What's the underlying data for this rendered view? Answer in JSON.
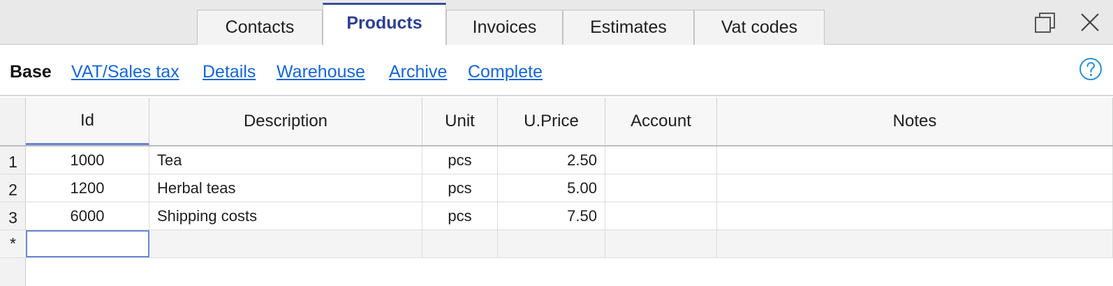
{
  "tabs": [
    {
      "label": "Contacts",
      "active": false
    },
    {
      "label": "Products",
      "active": true
    },
    {
      "label": "Invoices",
      "active": false
    },
    {
      "label": "Estimates",
      "active": false
    },
    {
      "label": "Vat codes",
      "active": false
    }
  ],
  "window_controls": {
    "restore_icon": "restore-window-icon",
    "close_icon": "close-icon"
  },
  "subnav": {
    "items": [
      {
        "label": "Base",
        "current": true
      },
      {
        "label": "VAT/Sales tax",
        "current": false
      },
      {
        "label": "Details",
        "current": false
      },
      {
        "label": "Warehouse",
        "current": false
      },
      {
        "label": "Archive",
        "current": false
      },
      {
        "label": "Complete",
        "current": false
      }
    ],
    "help_icon": "help-circle-icon"
  },
  "table": {
    "columns": [
      "Id",
      "Description",
      "Unit",
      "U.Price",
      "Account",
      "Notes"
    ],
    "rows": [
      {
        "num": "1",
        "id": "1000",
        "description": "Tea",
        "unit": "pcs",
        "price": "2.50",
        "account": "",
        "notes": ""
      },
      {
        "num": "2",
        "id": "1200",
        "description": "Herbal teas",
        "unit": "pcs",
        "price": "5.00",
        "account": "",
        "notes": ""
      },
      {
        "num": "3",
        "id": "6000",
        "description": "Shipping costs",
        "unit": "pcs",
        "price": "7.50",
        "account": "",
        "notes": ""
      }
    ],
    "new_row_marker": "*"
  },
  "colors": {
    "accent": "#3a4e9c",
    "link": "#1666d6",
    "selection": "#6b84d6"
  }
}
